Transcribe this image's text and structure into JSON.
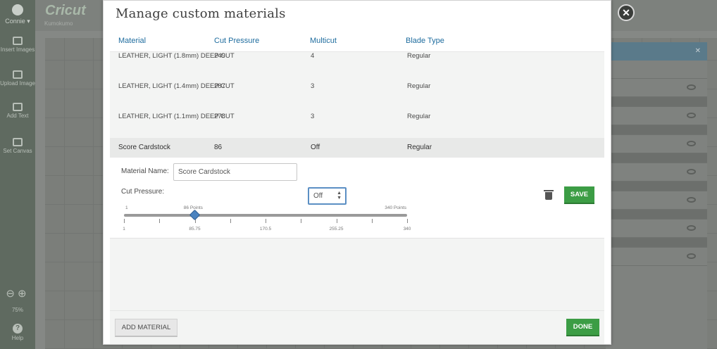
{
  "app": {
    "brand": "Cricut",
    "user": "Connie",
    "project": "Kumokumo",
    "zoom": "75%",
    "tools": [
      {
        "label": "Insert Images",
        "icon": "image-icon"
      },
      {
        "label": "Upload Image",
        "icon": "upload-icon"
      },
      {
        "label": "Add Text",
        "icon": "text-icon"
      },
      {
        "label": "Set Canvas",
        "icon": "shirt-icon"
      }
    ],
    "help": "Help"
  },
  "modal": {
    "title": "Manage custom materials",
    "columns": [
      "Material",
      "Cut Pressure",
      "Multicut",
      "Blade Type"
    ],
    "rows": [
      {
        "material": "LEATHER, LIGHT (1.8mm) DEEP CUT",
        "cut_pressure": "249",
        "multicut": "4",
        "blade": "Regular"
      },
      {
        "material": "LEATHER, LIGHT (1.4mm) DEEP CUT",
        "cut_pressure": "287",
        "multicut": "3",
        "blade": "Regular"
      },
      {
        "material": "LEATHER, LIGHT (1.1mm) DEEP CUT",
        "cut_pressure": "278",
        "multicut": "3",
        "blade": "Regular"
      }
    ],
    "selected": {
      "material": "Score Cardstock",
      "cut_pressure": "86",
      "multicut": "Off",
      "blade": "Regular"
    },
    "editor": {
      "name_label": "Material Name:",
      "name_value": "Score Cardstock",
      "pressure_label": "Cut Pressure:",
      "multicut_value": "Off",
      "slider": {
        "min": 1,
        "max": 340,
        "value": 86,
        "min_label": "1",
        "value_label": "86 Points",
        "max_label": "340 Points",
        "tick_labels": [
          "1",
          "85.75",
          "170.5",
          "255.25",
          "340"
        ]
      },
      "save_label": "SAVE"
    },
    "add_label": "ADD MATERIAL",
    "done_label": "DONE"
  }
}
